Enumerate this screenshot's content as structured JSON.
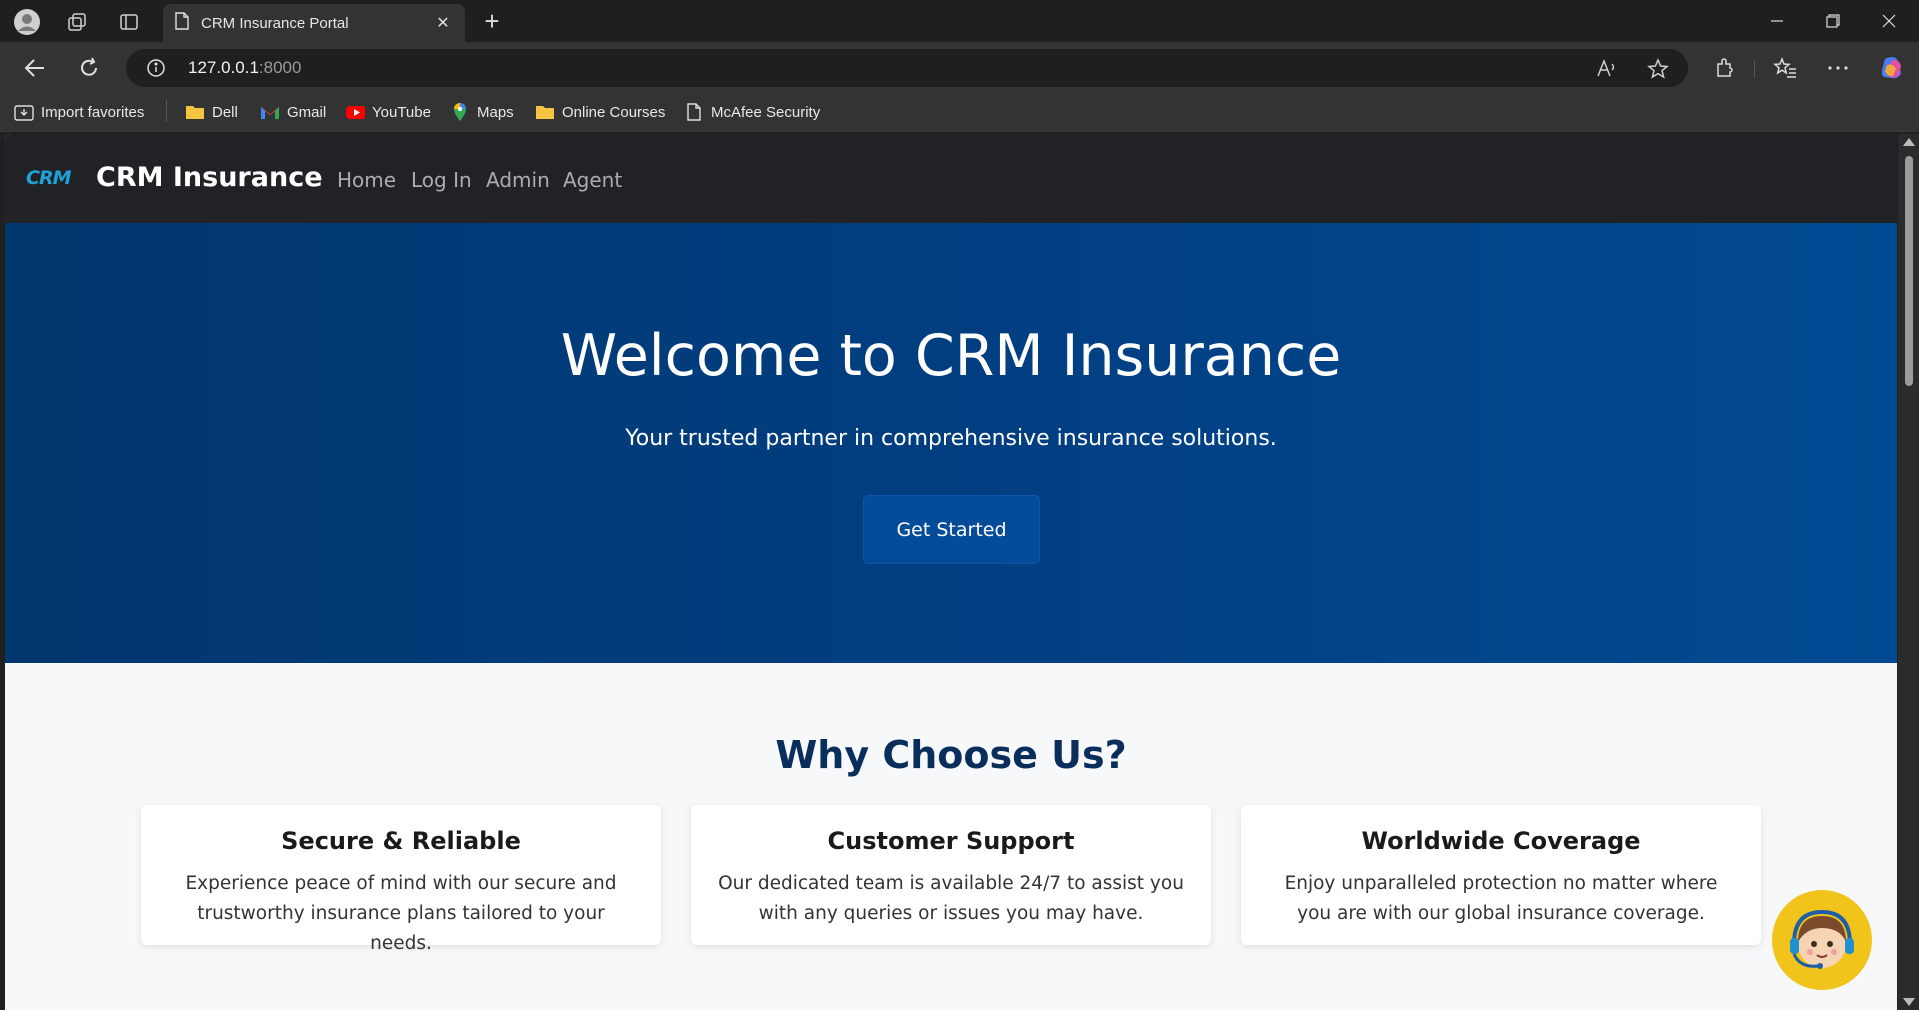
{
  "browser": {
    "tab_title": "CRM Insurance Portal",
    "address_host": "127.0.0.1",
    "address_port": ":8000",
    "bookmarks": [
      {
        "label": "Import favorites",
        "icon": "import-icon"
      },
      {
        "label": "Dell",
        "icon": "folder-icon"
      },
      {
        "label": "Gmail",
        "icon": "gmail-icon"
      },
      {
        "label": "YouTube",
        "icon": "youtube-icon"
      },
      {
        "label": "Maps",
        "icon": "maps-icon"
      },
      {
        "label": "Online Courses",
        "icon": "folder-icon"
      },
      {
        "label": "McAfee Security",
        "icon": "page-icon"
      }
    ]
  },
  "site": {
    "logo_text": "CRM",
    "brand": "CRM Insurance",
    "nav": [
      "Home",
      "Log In",
      "Admin",
      "Agent"
    ]
  },
  "hero": {
    "title": "Welcome to CRM Insurance",
    "subtitle": "Your trusted partner in comprehensive insurance solutions.",
    "cta": "Get Started"
  },
  "why": {
    "title": "Why Choose Us?",
    "cards": [
      {
        "title": "Secure & Reliable",
        "text": "Experience peace of mind with our secure and trustworthy insurance plans tailored to your needs."
      },
      {
        "title": "Customer Support",
        "text": "Our dedicated team is available 24/7 to assist you with any queries or issues you may have."
      },
      {
        "title": "Worldwide Coverage",
        "text": "Enjoy unparalleled protection no matter where you are with our global insurance coverage."
      }
    ]
  },
  "colors": {
    "hero_bg": "#013f82",
    "nav_bg": "#202226",
    "heading": "#0a2e5c",
    "chatbot": "#f0c41b"
  }
}
